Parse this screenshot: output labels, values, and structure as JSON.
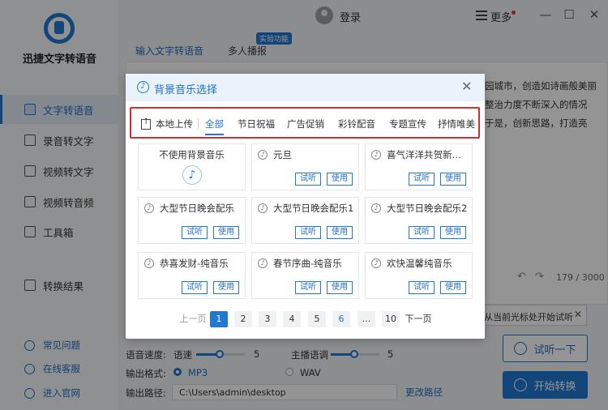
{
  "app": {
    "name": "迅捷文字转语音",
    "login": "登录",
    "more": "更多",
    "window_controls": [
      "minimize-icon",
      "maximize-icon",
      "close-icon"
    ]
  },
  "sidebar": {
    "items": [
      {
        "label": "文字转语音",
        "icon": "text-to-speech-icon",
        "active": true
      },
      {
        "label": "录音转文字",
        "icon": "recording-icon"
      },
      {
        "label": "视频转文字",
        "icon": "video-text-icon"
      },
      {
        "label": "视频转音频",
        "icon": "video-audio-icon"
      },
      {
        "label": "工具箱",
        "icon": "toolbox-icon"
      },
      {
        "label": "转换结果",
        "icon": "result-icon"
      }
    ],
    "footer": [
      {
        "label": "常见问题",
        "icon": "help-icon"
      },
      {
        "label": "在线客服",
        "icon": "headset-icon"
      },
      {
        "label": "进入官网",
        "icon": "website-icon"
      }
    ]
  },
  "main": {
    "tabs": [
      "输入文字转语音",
      "多人播报"
    ],
    "badge": "实验功能",
    "bg_text": [
      "园城市，创造如诗画般美丽",
      "整治力度不断深入的情况",
      "于是，创新思路，打造亮"
    ],
    "char_count": "179 / 3000",
    "tip": "从当前光标处开始试听",
    "speed_label": "语音速度:",
    "speed_sub": "语速",
    "speed_value": "5",
    "pitch_label": "主播语调",
    "pitch_value": "5",
    "format_label": "输出格式:",
    "format_options": [
      "MP3",
      "WAV"
    ],
    "path_label": "输出路径:",
    "path_value": "C:\\Users\\admin\\desktop",
    "change_path": "更改路径",
    "listen_button": "试听一下",
    "convert_button": "开始转换"
  },
  "modal": {
    "title": "背景音乐选择",
    "upload": "本地上传",
    "categories": [
      "全部",
      "节日祝福",
      "广告促销",
      "彩铃配音",
      "专题宣传",
      "抒情唯美"
    ],
    "active_category": "全部",
    "none_option": "不使用背景音乐",
    "cards": [
      {
        "title": "元旦"
      },
      {
        "title": "喜气洋洋共贺新年..."
      },
      {
        "title": "大型节日晚会配乐"
      },
      {
        "title": "大型节日晚会配乐1"
      },
      {
        "title": "大型节日晚会配乐2"
      },
      {
        "title": "恭喜发财-纯音乐"
      },
      {
        "title": "春节序曲-纯音乐"
      },
      {
        "title": "欢快温馨纯音乐"
      }
    ],
    "listen_label": "试听",
    "use_label": "使用",
    "pagination": {
      "prev": "上一页",
      "pages": [
        "1",
        "2",
        "3",
        "4",
        "5",
        "6",
        "...",
        "10"
      ],
      "current": "1",
      "next": "下一页"
    }
  }
}
